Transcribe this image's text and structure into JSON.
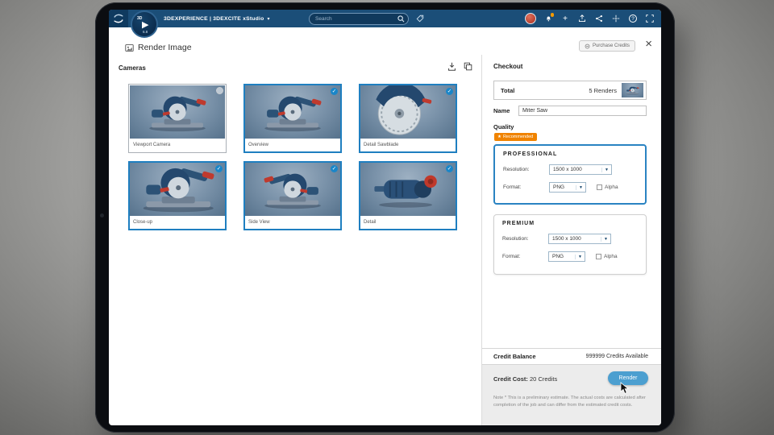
{
  "topbar": {
    "brand": "3DEXPERIENCE | 3DEXCITE xStudio",
    "search_placeholder": "Search",
    "app_badge": {
      "label": "3D",
      "version": "6.8"
    }
  },
  "dialog": {
    "title": "Render Image",
    "purchase_credits_label": "Purchase Credits"
  },
  "cameras": {
    "heading": "Cameras",
    "items": [
      {
        "label": "Viewport Camera",
        "selected": false
      },
      {
        "label": "Overview",
        "selected": true
      },
      {
        "label": "Detail Sawblade",
        "selected": true
      },
      {
        "label": "Close-up",
        "selected": true
      },
      {
        "label": "Side View",
        "selected": true
      },
      {
        "label": "Detail",
        "selected": true
      }
    ]
  },
  "checkout": {
    "heading": "Checkout",
    "total_label": "Total",
    "total_value": "5 Renders",
    "name_label": "Name",
    "name_value": "Miter Saw",
    "quality_label": "Quality",
    "recommended_badge": "Recommended",
    "tiers": [
      {
        "name": "PROFESSIONAL",
        "resolution_label": "Resolution:",
        "resolution_value": "1500 x 1000",
        "format_label": "Format:",
        "format_value": "PNG",
        "alpha_label": "Alpha",
        "selected": true
      },
      {
        "name": "PREMIUM",
        "resolution_label": "Resolution:",
        "resolution_value": "1500 x 1000",
        "format_label": "Format:",
        "format_value": "PNG",
        "alpha_label": "Alpha",
        "selected": false
      }
    ],
    "credit_balance_label": "Credit Balance",
    "credit_balance_value": "999999 Credits Available",
    "credit_cost_label": "Credit Cost:",
    "credit_cost_value": "20 Credits",
    "render_label": "Render",
    "note": "Note * This is a preliminary estimate. The actual costs are calculated after completion of the job and can differ from the estimated credit costs."
  },
  "colors": {
    "topbar_blue": "#1b4e78",
    "accent_blue": "#1f7fc0",
    "recommended_orange": "#f08300",
    "render_button_blue": "#4c9fd0"
  }
}
